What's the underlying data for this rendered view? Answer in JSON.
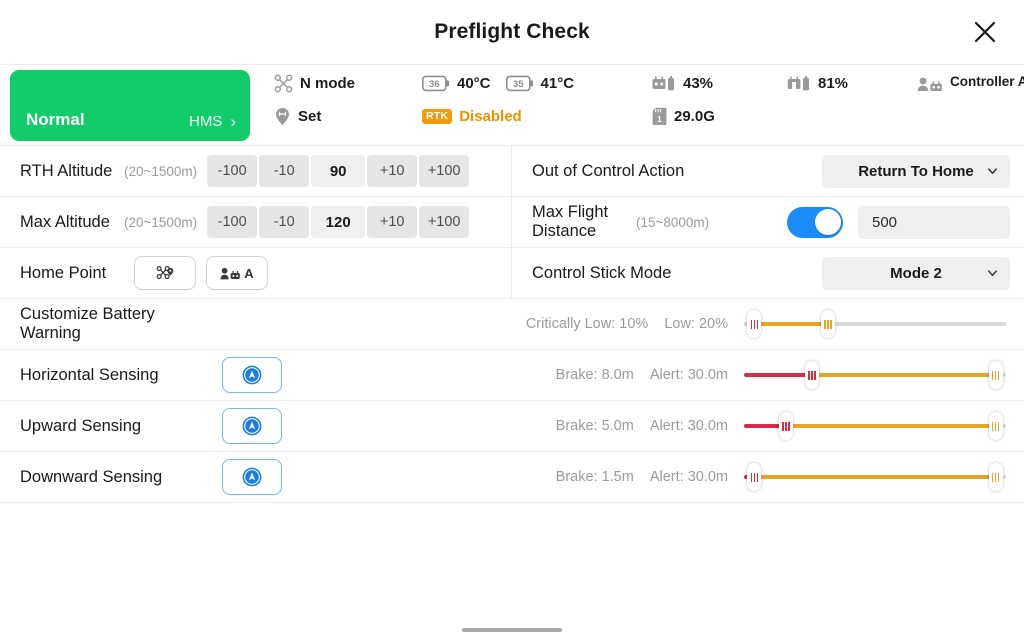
{
  "header": {
    "title": "Preflight Check",
    "close_icon": "close-icon"
  },
  "status": {
    "hms": {
      "state": "Normal",
      "link_label": "HMS",
      "chevron": "›",
      "color": "#12cc6a"
    },
    "flight_mode": {
      "icon": "drone-icon",
      "label": "N mode"
    },
    "home_point": {
      "icon": "home-pin-icon",
      "label": "Set"
    },
    "battery_temp_1": {
      "icon": "battery-temp-icon",
      "badge": "36",
      "label": "40°C"
    },
    "battery_temp_2": {
      "icon": "battery-temp-icon",
      "badge": "35",
      "label": "41°C"
    },
    "rtk": {
      "badge": "RTK",
      "label": "Disabled",
      "color": "#f09000"
    },
    "aircraft_battery": {
      "icon": "aircraft-battery-icon",
      "label": "43%"
    },
    "sd_card": {
      "icon": "sd-card-icon",
      "label": "29.0G"
    },
    "rc_battery": {
      "icon": "rc-battery-icon",
      "label": "81%"
    },
    "controller": {
      "icon": "controller-user-icon",
      "label": "Controller A"
    }
  },
  "left_panel": {
    "rth_altitude": {
      "label": "RTH Altitude",
      "range_hint": "(20~1500m)",
      "minus_big": "-100",
      "minus_small": "-10",
      "value": "90",
      "plus_small": "+10",
      "plus_big": "+100"
    },
    "max_altitude": {
      "label": "Max Altitude",
      "range_hint": "(20~1500m)",
      "minus_big": "-100",
      "minus_small": "-10",
      "value": "120",
      "plus_small": "+10",
      "plus_big": "+100"
    },
    "home_point": {
      "label": "Home Point",
      "option_aircraft_icon": "drone-pin-icon",
      "option_controller_icon": "controller-person-icon",
      "option_controller_letter": "A"
    }
  },
  "right_panel": {
    "out_of_control": {
      "label": "Out of Control Action",
      "value": "Return To Home",
      "chevron_icon": "chevron-down-icon"
    },
    "max_flight_distance": {
      "label": "Max Flight Distance",
      "range_hint": "(15~8000m)",
      "enabled": true,
      "toggle_color": "#1a8cf5",
      "value": "500"
    },
    "control_stick_mode": {
      "label": "Control Stick Mode",
      "value": "Mode 2",
      "chevron_icon": "chevron-down-icon"
    }
  },
  "battery_warning": {
    "label": "Customize Battery Warning",
    "critically_low": "Critically Low: 10%",
    "low": "Low: 20%",
    "slider": {
      "handle1_pct": 4,
      "handle2_pct": 32,
      "fill_color": "#e8a423",
      "handle1_color": "#d82b45",
      "handle2_color": "#e8a423"
    }
  },
  "sensing_rows": [
    {
      "label": "Horizontal Sensing",
      "icon": "sensing-enabled-icon",
      "brake": "Brake: 8.0m",
      "alert": "Alert: 30.0m",
      "slider": {
        "handle1_pct": 26,
        "handle2_pct": 96
      }
    },
    {
      "label": "Upward Sensing",
      "icon": "sensing-enabled-icon",
      "brake": "Brake: 5.0m",
      "alert": "Alert: 30.0m",
      "slider": {
        "handle1_pct": 16,
        "handle2_pct": 96
      }
    },
    {
      "label": "Downward Sensing",
      "icon": "sensing-enabled-icon",
      "brake": "Brake: 1.5m",
      "alert": "Alert: 30.0m",
      "slider": {
        "handle1_pct": 4,
        "handle2_pct": 96
      }
    }
  ],
  "home_indicator": "home-indicator-bar"
}
